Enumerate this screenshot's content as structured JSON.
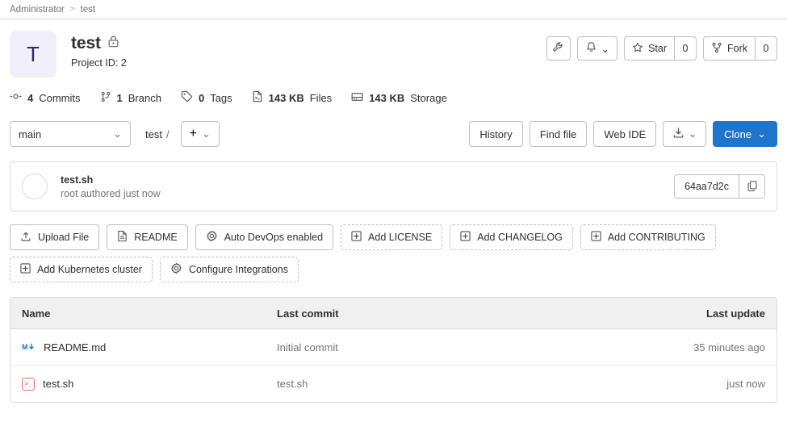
{
  "breadcrumb": {
    "owner": "Administrator",
    "separator": ">",
    "project": "test"
  },
  "project": {
    "avatar_letter": "T",
    "name": "test",
    "visibility_icon": "lock-icon",
    "project_id_label": "Project ID: 2"
  },
  "header_actions": {
    "settings_icon": "wrench-icon",
    "notifications_icon": "bell-icon",
    "notifications_caret": "⌄",
    "star_icon": "star-icon",
    "star_label": "Star",
    "star_count": "0",
    "fork_icon": "fork-icon",
    "fork_label": "Fork",
    "fork_count": "0"
  },
  "stats": [
    {
      "icon": "commit-icon",
      "value": "4",
      "label": "Commits"
    },
    {
      "icon": "branch-icon",
      "value": "1",
      "label": "Branch"
    },
    {
      "icon": "tag-icon",
      "value": "0",
      "label": "Tags"
    },
    {
      "icon": "file-icon",
      "value": "143 KB",
      "label": "Files"
    },
    {
      "icon": "storage-icon",
      "value": "143 KB",
      "label": "Storage"
    }
  ],
  "toolbar": {
    "branch": "main",
    "branch_caret": "⌄",
    "path_root": "test",
    "path_separator": "/",
    "plus_label": "+",
    "plus_caret": "⌄",
    "history_label": "History",
    "find_file_label": "Find file",
    "web_ide_label": "Web IDE",
    "download_icon": "download-icon",
    "download_caret": "⌄",
    "clone_label": "Clone",
    "clone_caret": "⌄",
    "clone_color": "#1f75cb"
  },
  "last_commit": {
    "avatar": "user-avatar",
    "title": "test.sh",
    "subtitle": "root authored just now",
    "sha": "64aa7d2c",
    "copy_icon": "copy-icon"
  },
  "quick_actions": {
    "row1": [
      {
        "icon": "upload-icon",
        "label": "Upload File",
        "dashed": false
      },
      {
        "icon": "document-icon",
        "label": "README",
        "dashed": false
      },
      {
        "icon": "gear-icon",
        "label": "Auto DevOps enabled",
        "dashed": false
      },
      {
        "icon": "plus-square-icon",
        "label": "Add LICENSE",
        "dashed": true
      },
      {
        "icon": "plus-square-icon",
        "label": "Add CHANGELOG",
        "dashed": true
      },
      {
        "icon": "plus-square-icon",
        "label": "Add CONTRIBUTING",
        "dashed": true
      }
    ],
    "row2": [
      {
        "icon": "plus-square-icon",
        "label": "Add Kubernetes cluster",
        "dashed": true
      },
      {
        "icon": "gear-icon",
        "label": "Configure Integrations",
        "dashed": true
      }
    ]
  },
  "file_table": {
    "columns": {
      "name": "Name",
      "last_commit": "Last commit",
      "last_update": "Last update"
    },
    "rows": [
      {
        "icon": "markdown-file-icon",
        "name": "README.md",
        "last_commit": "Initial commit",
        "last_update": "35 minutes ago"
      },
      {
        "icon": "shell-file-icon",
        "name": "test.sh",
        "last_commit": "test.sh",
        "last_update": "just now"
      }
    ]
  }
}
